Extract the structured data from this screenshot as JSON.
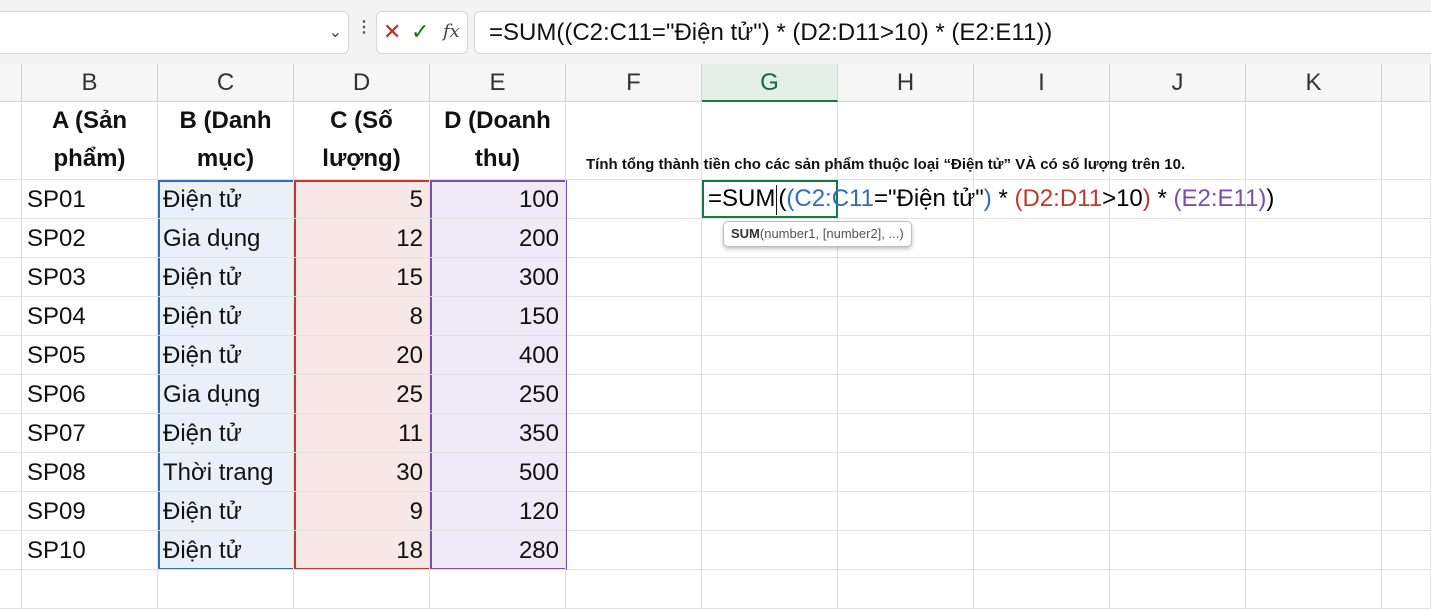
{
  "formula_bar": {
    "name_box": "",
    "cancel_icon": "✕",
    "enter_icon": "✓",
    "fx_label": "fx",
    "formula": "=SUM((C2:C11=\"Điện tử\") * (D2:D11>10) * (E2:E11))"
  },
  "columns": [
    "B",
    "C",
    "D",
    "E",
    "F",
    "G",
    "H",
    "I",
    "J",
    "K"
  ],
  "active_column": "G",
  "headers": {
    "b": [
      "A (Sản",
      "phẩm)"
    ],
    "c": [
      "B (Danh",
      "mục)"
    ],
    "d": [
      "C (Số",
      "lượng)"
    ],
    "e": [
      "D (Doanh",
      "thu)"
    ]
  },
  "rows": [
    {
      "product": "SP01",
      "category": "Điện tử",
      "qty": "5",
      "revenue": "100"
    },
    {
      "product": "SP02",
      "category": "Gia dụng",
      "qty": "12",
      "revenue": "200"
    },
    {
      "product": "SP03",
      "category": "Điện tử",
      "qty": "15",
      "revenue": "300"
    },
    {
      "product": "SP04",
      "category": "Điện tử",
      "qty": "8",
      "revenue": "150"
    },
    {
      "product": "SP05",
      "category": "Điện tử",
      "qty": "20",
      "revenue": "400"
    },
    {
      "product": "SP06",
      "category": "Gia dụng",
      "qty": "25",
      "revenue": "250"
    },
    {
      "product": "SP07",
      "category": "Điện tử",
      "qty": "11",
      "revenue": "350"
    },
    {
      "product": "SP08",
      "category": "Thời trang",
      "qty": "30",
      "revenue": "500"
    },
    {
      "product": "SP09",
      "category": "Điện tử",
      "qty": "9",
      "revenue": "120"
    },
    {
      "product": "SP10",
      "category": "Điện tử",
      "qty": "18",
      "revenue": "280"
    }
  ],
  "note": "Tính tổng thành tiền cho các sản phẩm thuộc loại “Điện tử” VÀ có số lượng trên 10.",
  "edit_formula": {
    "p1": "=SUM",
    "p2": "(",
    "p3": "(",
    "p4": "C2:C11",
    "p5": "=\"Điện tử\"",
    "p6": ")",
    "p7": " * ",
    "p8": "(",
    "p9": "D2:D11",
    "p10": ">10",
    "p11": ")",
    "p12": " * ",
    "p13": "(",
    "p14": "E2:E11",
    "p15": ")",
    "p16": ")"
  },
  "tooltip": {
    "fn": "SUM",
    "args": "(number1, [number2], ...)"
  },
  "colors": {
    "blue": "#2f6ebd",
    "red": "#c0392b",
    "purple": "#7a4fb0",
    "green": "#107c41"
  }
}
